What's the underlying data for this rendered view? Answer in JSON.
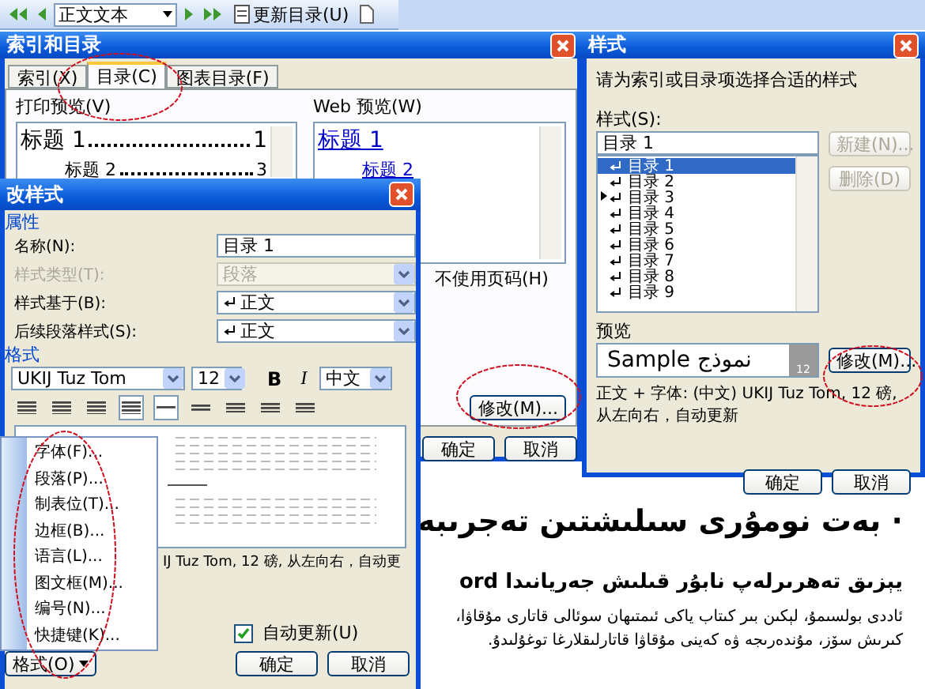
{
  "toolbar": {
    "style_box": "正文文本",
    "update_button": "更新目录(U)"
  },
  "index_dialog": {
    "title": "索引和目录",
    "tabs": [
      {
        "label": "索引(X)",
        "selected": false
      },
      {
        "label": "目录(C)",
        "selected": true
      },
      {
        "label": "图表目录(F)",
        "selected": false
      }
    ],
    "print_preview": {
      "label": "打印预览(V)",
      "entries": [
        {
          "text": "标题 1",
          "page": "1",
          "children": [
            {
              "text": "标题 2",
              "page": "3"
            }
          ]
        }
      ]
    },
    "web_preview": {
      "label": "Web 预览(W)",
      "links": [
        {
          "text": "标题 1",
          "children": [
            {
              "text": "标题 2"
            }
          ]
        }
      ]
    },
    "hyperlink_option": "不使用页码(H)",
    "modify_button": "修改(M)...",
    "buttons": [
      "确定",
      "取消"
    ]
  },
  "styles_dialog": {
    "title": "样式",
    "prompt": "请为索引或目录项选择合适的样式",
    "styles_label": "样式(S):",
    "style_field": "目录 1",
    "styles": [
      {
        "name": "目录 1",
        "selected": true,
        "marked": false
      },
      {
        "name": "目录 2",
        "selected": false,
        "marked": false
      },
      {
        "name": "目录 3",
        "selected": false,
        "marked": true
      },
      {
        "name": "目录 4",
        "selected": false,
        "marked": false
      },
      {
        "name": "目录 5",
        "selected": false,
        "marked": false
      },
      {
        "name": "目录 6",
        "selected": false,
        "marked": false
      },
      {
        "name": "目录 7",
        "selected": false,
        "marked": false
      },
      {
        "name": "目录 8",
        "selected": false,
        "marked": false
      },
      {
        "name": "目录 9",
        "selected": false,
        "marked": false
      }
    ],
    "side_buttons": [
      {
        "label": "新建(N)...",
        "disabled": true
      },
      {
        "label": "删除(D)",
        "disabled": true
      }
    ],
    "preview_label": "预览",
    "preview_sample": "Sample نموذج",
    "preview_size": "12",
    "modify_button": "修改(M)...",
    "description": "正文 + 字体: (中文) UKIJ Tuz Tom, 12 磅, 从左向右，自动更新",
    "buttons": [
      "确定",
      "取消"
    ]
  },
  "modify_dialog": {
    "title": "改样式",
    "properties_label": "属性",
    "fields": [
      {
        "label": "名称(N):",
        "kind": "text",
        "value": "目录 1",
        "disabled": false
      },
      {
        "label": "样式类型(T):",
        "kind": "select",
        "value": "段落",
        "disabled": true
      },
      {
        "label": "样式基于(B):",
        "kind": "style-select",
        "value": "正文",
        "disabled": false
      },
      {
        "label": "后续段落样式(S):",
        "kind": "style-select",
        "value": "正文",
        "disabled": false
      }
    ],
    "format_label": "格式",
    "font": "UKIJ Tuz Tom",
    "size": "12",
    "bold_label": "B",
    "italic_label": "I",
    "script": "中文",
    "alignment": [
      {
        "selected": false
      },
      {
        "selected": false
      },
      {
        "selected": false
      },
      {
        "selected": true
      }
    ],
    "spacing": [
      {
        "selected": true
      },
      {
        "selected": false
      },
      {
        "selected": false
      }
    ],
    "description": "IJ Tuz Tom, 12 磅, 从左向右，自动更",
    "auto_update": {
      "label": "自动更新(U)",
      "checked": true
    },
    "format_button": "格式(O)",
    "buttons": [
      "确定",
      "取消"
    ]
  },
  "format_menu": {
    "items": [
      "字体(F)...",
      "段落(P)...",
      "制表位(T)...",
      "边框(B)...",
      "语言(L)...",
      "图文框(M)...",
      "编号(N)...",
      "快捷键(K)..."
    ]
  },
  "document": {
    "heading": "· بەت نومۇرى سىلىشتىن تەجرىبە",
    "subheading": "يېزىق تەھرىرلەپ نابۇر قىلىش جەريانىدا ord",
    "paragraph": "ئاددى بولسىمۇ، لېكىن بىر كىتاب ياكى ئىمتىھان سوئالى قاتارى مۇقاۋا، كىرىش سۆز، مۇندەرىجە ۋە كەينى مۇقاۋا قاتارلىقلارغا توغۇلىدۇ."
  }
}
